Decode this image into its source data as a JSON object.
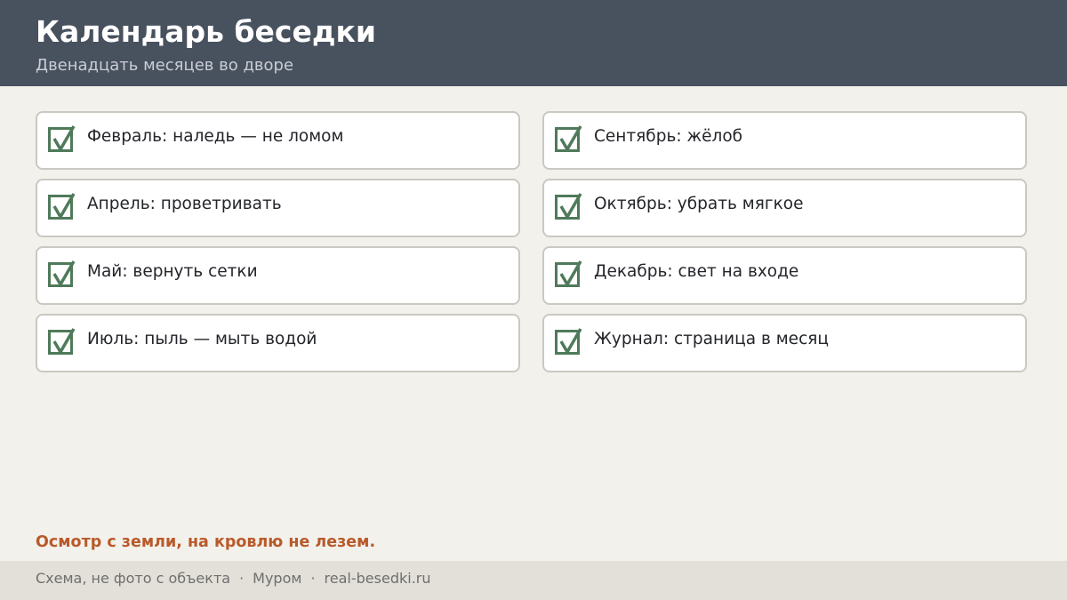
{
  "header": {
    "title": "Календарь беседки",
    "subtitle": "Двенадцать месяцев во дворе",
    "background": "#48515e"
  },
  "checklist": {
    "left": [
      {
        "label": "Февраль: наледь — не ломом",
        "checked": true
      },
      {
        "label": "Апрель: проветривать",
        "checked": true
      },
      {
        "label": "Май: вернуть сетки",
        "checked": true
      },
      {
        "label": "Июль: пыль — мыть водой",
        "checked": true
      }
    ],
    "right": [
      {
        "label": "Сентябрь: жёлоб",
        "checked": true
      },
      {
        "label": "Октябрь: убрать мягкое",
        "checked": true
      },
      {
        "label": "Декабрь: свет на входе",
        "checked": true
      },
      {
        "label": "Журнал: страница в месяц",
        "checked": true
      }
    ],
    "check_icon": "checkbox-checked-icon",
    "check_color": "#4f7a5a"
  },
  "note": {
    "text": "Осмотр с земли, на кровлю не лезем.",
    "color": "#b85a2a"
  },
  "footer": {
    "disclaimer": "Схема, не фото с объекта",
    "separator": "·",
    "city": "Муром",
    "site": "real-besedki.ru"
  }
}
